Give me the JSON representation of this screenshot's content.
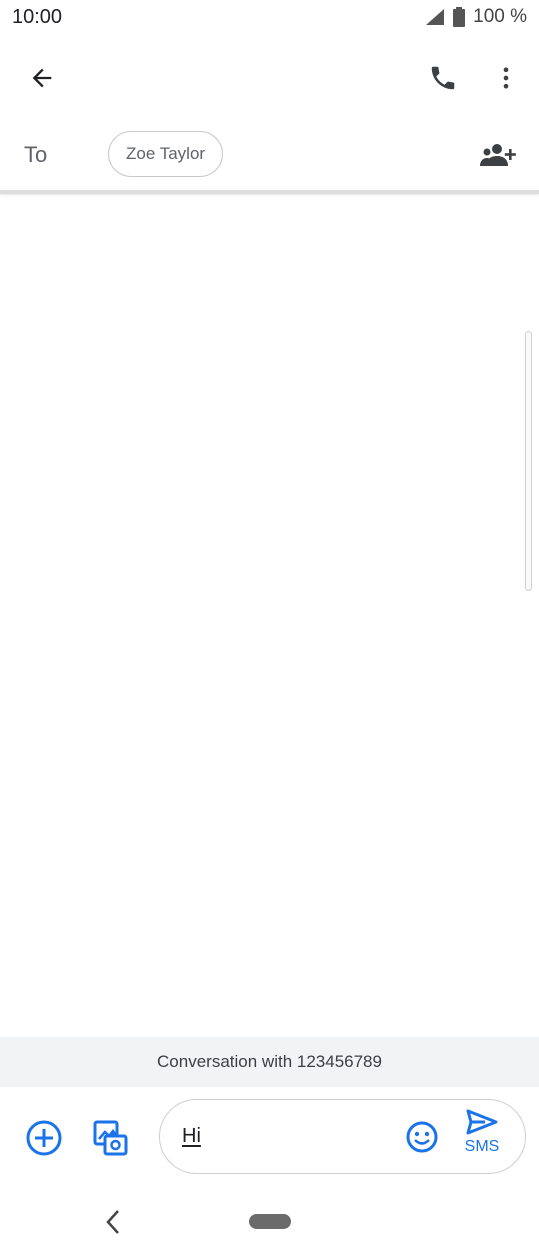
{
  "status_bar": {
    "time": "10:00",
    "battery": "100 %",
    "icons": [
      "signal-icon",
      "battery-icon"
    ]
  },
  "app_bar": {
    "icons": [
      "arrow-back-icon",
      "phone-icon",
      "more-vert-icon"
    ]
  },
  "recipient": {
    "to_label": "To",
    "chip_name": "Zoe Taylor",
    "add_icon": "add-contact-icon"
  },
  "conversation": {
    "banner": "Conversation with 123456789"
  },
  "compose": {
    "text": "Hi",
    "send_label": "SMS",
    "icons": [
      "add-circle-icon",
      "gallery-icon",
      "emoji-icon",
      "send-icon"
    ]
  },
  "nav_bar": {
    "icons": [
      "nav-back-icon",
      "nav-home-pill"
    ]
  },
  "colors": {
    "accent": "#1a73e8",
    "text_dark": "#202124",
    "text_muted": "#5f6368",
    "banner_bg": "#f1f3f4"
  }
}
